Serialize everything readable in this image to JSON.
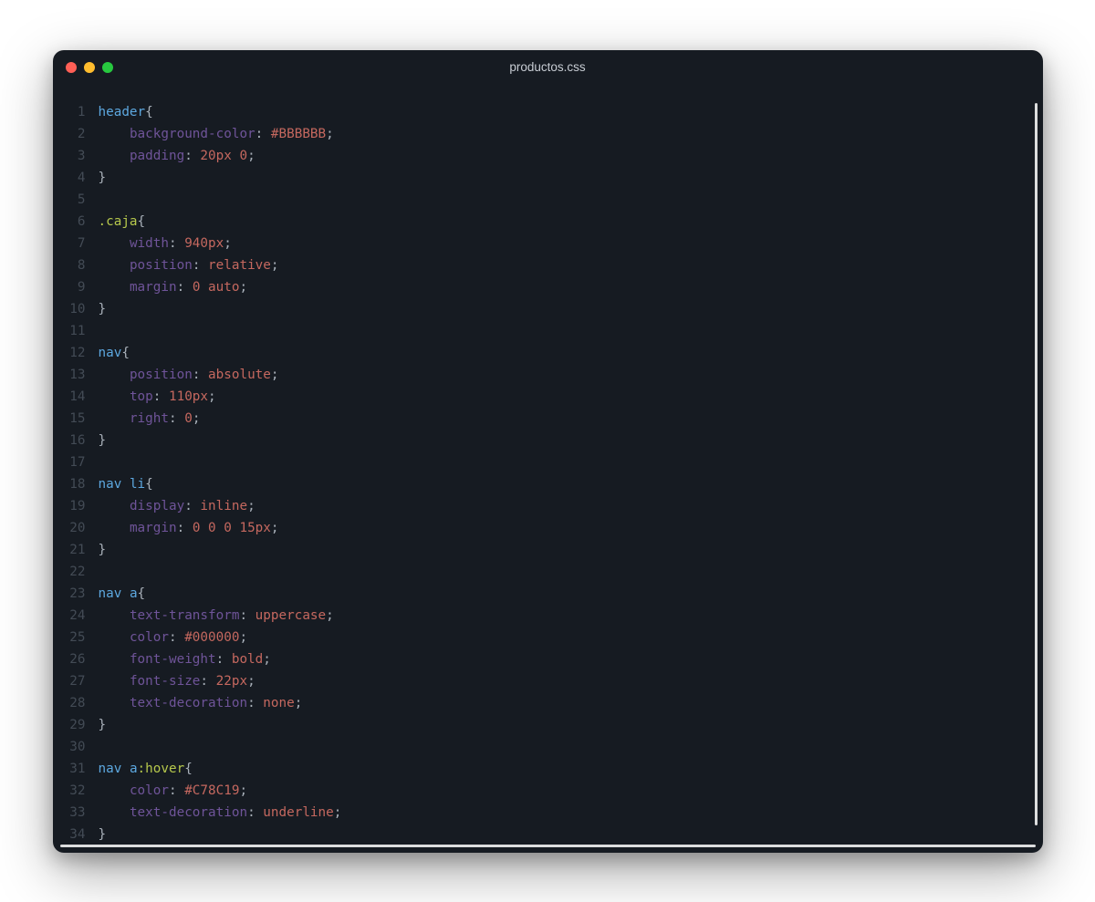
{
  "title": "productos.css",
  "code": [
    [
      {
        "c": "t-tag",
        "t": "header"
      },
      {
        "c": "t-punct",
        "t": "{"
      }
    ],
    [
      {
        "c": "",
        "t": "    "
      },
      {
        "c": "t-prop",
        "t": "background-color"
      },
      {
        "c": "t-punct",
        "t": ": "
      },
      {
        "c": "t-num",
        "t": "#BBBBBB"
      },
      {
        "c": "t-punct",
        "t": ";"
      }
    ],
    [
      {
        "c": "",
        "t": "    "
      },
      {
        "c": "t-prop",
        "t": "padding"
      },
      {
        "c": "t-punct",
        "t": ": "
      },
      {
        "c": "t-num",
        "t": "20px"
      },
      {
        "c": "",
        "t": " "
      },
      {
        "c": "t-num",
        "t": "0"
      },
      {
        "c": "t-punct",
        "t": ";"
      }
    ],
    [
      {
        "c": "t-punct",
        "t": "}"
      }
    ],
    [],
    [
      {
        "c": "t-class",
        "t": ".caja"
      },
      {
        "c": "t-punct",
        "t": "{"
      }
    ],
    [
      {
        "c": "",
        "t": "    "
      },
      {
        "c": "t-prop",
        "t": "width"
      },
      {
        "c": "t-punct",
        "t": ": "
      },
      {
        "c": "t-num",
        "t": "940px"
      },
      {
        "c": "t-punct",
        "t": ";"
      }
    ],
    [
      {
        "c": "",
        "t": "    "
      },
      {
        "c": "t-prop",
        "t": "position"
      },
      {
        "c": "t-punct",
        "t": ": "
      },
      {
        "c": "t-val",
        "t": "relative"
      },
      {
        "c": "t-punct",
        "t": ";"
      }
    ],
    [
      {
        "c": "",
        "t": "    "
      },
      {
        "c": "t-prop",
        "t": "margin"
      },
      {
        "c": "t-punct",
        "t": ": "
      },
      {
        "c": "t-num",
        "t": "0"
      },
      {
        "c": "",
        "t": " "
      },
      {
        "c": "t-val",
        "t": "auto"
      },
      {
        "c": "t-punct",
        "t": ";"
      }
    ],
    [
      {
        "c": "t-punct",
        "t": "}"
      }
    ],
    [],
    [
      {
        "c": "t-tag",
        "t": "nav"
      },
      {
        "c": "t-punct",
        "t": "{"
      }
    ],
    [
      {
        "c": "",
        "t": "    "
      },
      {
        "c": "t-prop",
        "t": "position"
      },
      {
        "c": "t-punct",
        "t": ": "
      },
      {
        "c": "t-val",
        "t": "absolute"
      },
      {
        "c": "t-punct",
        "t": ";"
      }
    ],
    [
      {
        "c": "",
        "t": "    "
      },
      {
        "c": "t-prop",
        "t": "top"
      },
      {
        "c": "t-punct",
        "t": ": "
      },
      {
        "c": "t-num",
        "t": "110px"
      },
      {
        "c": "t-punct",
        "t": ";"
      }
    ],
    [
      {
        "c": "",
        "t": "    "
      },
      {
        "c": "t-prop",
        "t": "right"
      },
      {
        "c": "t-punct",
        "t": ": "
      },
      {
        "c": "t-num",
        "t": "0"
      },
      {
        "c": "t-punct",
        "t": ";"
      }
    ],
    [
      {
        "c": "t-punct",
        "t": "}"
      }
    ],
    [],
    [
      {
        "c": "t-tag",
        "t": "nav"
      },
      {
        "c": "",
        "t": " "
      },
      {
        "c": "t-tag",
        "t": "li"
      },
      {
        "c": "t-punct",
        "t": "{"
      }
    ],
    [
      {
        "c": "",
        "t": "    "
      },
      {
        "c": "t-prop",
        "t": "display"
      },
      {
        "c": "t-punct",
        "t": ": "
      },
      {
        "c": "t-val",
        "t": "inline"
      },
      {
        "c": "t-punct",
        "t": ";"
      }
    ],
    [
      {
        "c": "",
        "t": "    "
      },
      {
        "c": "t-prop",
        "t": "margin"
      },
      {
        "c": "t-punct",
        "t": ": "
      },
      {
        "c": "t-num",
        "t": "0"
      },
      {
        "c": "",
        "t": " "
      },
      {
        "c": "t-num",
        "t": "0"
      },
      {
        "c": "",
        "t": " "
      },
      {
        "c": "t-num",
        "t": "0"
      },
      {
        "c": "",
        "t": " "
      },
      {
        "c": "t-num",
        "t": "15px"
      },
      {
        "c": "t-punct",
        "t": ";"
      }
    ],
    [
      {
        "c": "t-punct",
        "t": "}"
      }
    ],
    [],
    [
      {
        "c": "t-tag",
        "t": "nav"
      },
      {
        "c": "",
        "t": " "
      },
      {
        "c": "t-tag",
        "t": "a"
      },
      {
        "c": "t-punct",
        "t": "{"
      }
    ],
    [
      {
        "c": "",
        "t": "    "
      },
      {
        "c": "t-prop",
        "t": "text-transform"
      },
      {
        "c": "t-punct",
        "t": ": "
      },
      {
        "c": "t-val",
        "t": "uppercase"
      },
      {
        "c": "t-punct",
        "t": ";"
      }
    ],
    [
      {
        "c": "",
        "t": "    "
      },
      {
        "c": "t-prop",
        "t": "color"
      },
      {
        "c": "t-punct",
        "t": ": "
      },
      {
        "c": "t-num",
        "t": "#000000"
      },
      {
        "c": "t-punct",
        "t": ";"
      }
    ],
    [
      {
        "c": "",
        "t": "    "
      },
      {
        "c": "t-prop",
        "t": "font-weight"
      },
      {
        "c": "t-punct",
        "t": ": "
      },
      {
        "c": "t-val",
        "t": "bold"
      },
      {
        "c": "t-punct",
        "t": ";"
      }
    ],
    [
      {
        "c": "",
        "t": "    "
      },
      {
        "c": "t-prop",
        "t": "font-size"
      },
      {
        "c": "t-punct",
        "t": ": "
      },
      {
        "c": "t-num",
        "t": "22px"
      },
      {
        "c": "t-punct",
        "t": ";"
      }
    ],
    [
      {
        "c": "",
        "t": "    "
      },
      {
        "c": "t-prop",
        "t": "text-decoration"
      },
      {
        "c": "t-punct",
        "t": ": "
      },
      {
        "c": "t-val",
        "t": "none"
      },
      {
        "c": "t-punct",
        "t": ";"
      }
    ],
    [
      {
        "c": "t-punct",
        "t": "}"
      }
    ],
    [],
    [
      {
        "c": "t-tag",
        "t": "nav"
      },
      {
        "c": "",
        "t": " "
      },
      {
        "c": "t-tag",
        "t": "a"
      },
      {
        "c": "t-pseudo",
        "t": ":hover"
      },
      {
        "c": "t-punct",
        "t": "{"
      }
    ],
    [
      {
        "c": "",
        "t": "    "
      },
      {
        "c": "t-prop",
        "t": "color"
      },
      {
        "c": "t-punct",
        "t": ": "
      },
      {
        "c": "t-num",
        "t": "#C78C19"
      },
      {
        "c": "t-punct",
        "t": ";"
      }
    ],
    [
      {
        "c": "",
        "t": "    "
      },
      {
        "c": "t-prop",
        "t": "text-decoration"
      },
      {
        "c": "t-punct",
        "t": ": "
      },
      {
        "c": "t-val",
        "t": "underline"
      },
      {
        "c": "t-punct",
        "t": ";"
      }
    ],
    [
      {
        "c": "t-punct",
        "t": "}"
      }
    ]
  ]
}
